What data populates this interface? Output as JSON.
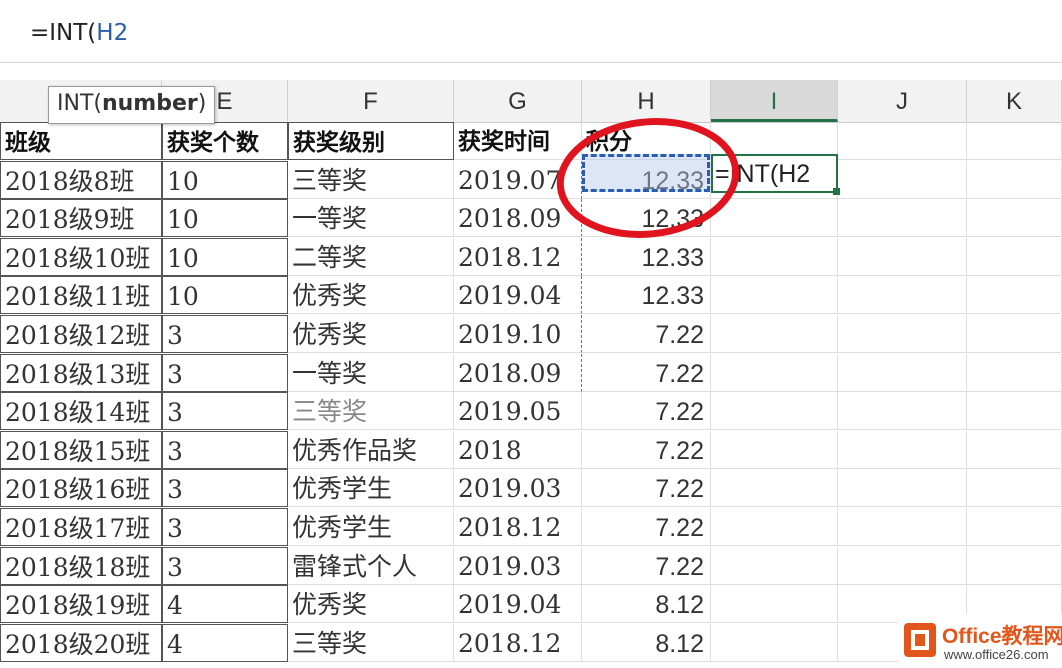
{
  "formula_bar": {
    "formula_prefix": "=INT(",
    "formula_ref": "H2"
  },
  "tooltip": {
    "func": "INT(",
    "arg": "number",
    "close": ")"
  },
  "columns": [
    {
      "id": "D",
      "label": ""
    },
    {
      "id": "E",
      "label": "E"
    },
    {
      "id": "F",
      "label": "F"
    },
    {
      "id": "G",
      "label": "G"
    },
    {
      "id": "H",
      "label": "H"
    },
    {
      "id": "I",
      "label": "I"
    },
    {
      "id": "J",
      "label": "J"
    },
    {
      "id": "K",
      "label": "K"
    }
  ],
  "header_row": {
    "D": "班级",
    "E": "获奖个数",
    "F": "获奖级别",
    "G": "获奖时间",
    "H": "积分"
  },
  "rows": [
    {
      "D": "2018级8班",
      "E": "10",
      "F": "三等奖",
      "G": "2019.07",
      "H": "12.33"
    },
    {
      "D": "2018级9班",
      "E": "10",
      "F": "一等奖",
      "G": "2018.09",
      "H": "12.33"
    },
    {
      "D": "2018级10班",
      "E": "10",
      "F": "二等奖",
      "G": "2018.12",
      "H": "12.33"
    },
    {
      "D": "2018级11班",
      "E": "10",
      "F": "优秀奖",
      "G": "2019.04",
      "H": "12.33"
    },
    {
      "D": "2018级12班",
      "E": "3",
      "F": "优秀奖",
      "G": "2019.10",
      "H": "7.22"
    },
    {
      "D": "2018级13班",
      "E": "3",
      "F": "一等奖",
      "G": "2018.09",
      "H": "7.22"
    },
    {
      "D": "2018级14班",
      "E": "3",
      "F": "三等奖",
      "G": "2019.05",
      "H": "7.22"
    },
    {
      "D": "2018级15班",
      "E": "3",
      "F": "优秀作品奖",
      "G": "2018",
      "H": "7.22"
    },
    {
      "D": "2018级16班",
      "E": "3",
      "F": "优秀学生",
      "G": "2019.03",
      "H": "7.22"
    },
    {
      "D": "2018级17班",
      "E": "3",
      "F": "优秀学生",
      "G": "2018.12",
      "H": "7.22"
    },
    {
      "D": "2018级18班",
      "E": "3",
      "F": "雷锋式个人",
      "G": "2019.03",
      "H": "7.22"
    },
    {
      "D": "2018级19班",
      "E": "4",
      "F": "优秀奖",
      "G": "2019.04",
      "H": "8.12"
    },
    {
      "D": "2018级20班",
      "E": "4",
      "F": "三等奖",
      "G": "2018.12",
      "H": "8.12"
    }
  ],
  "active_cell": {
    "text": "=INT(H2"
  },
  "watermark": {
    "title": "Office教程网",
    "url": "www.office26.com"
  },
  "colors": {
    "accent_green": "#217346",
    "ref_blue": "#2a5db0",
    "circle_red": "#e0141e",
    "watermark_orange": "#e2561c"
  }
}
